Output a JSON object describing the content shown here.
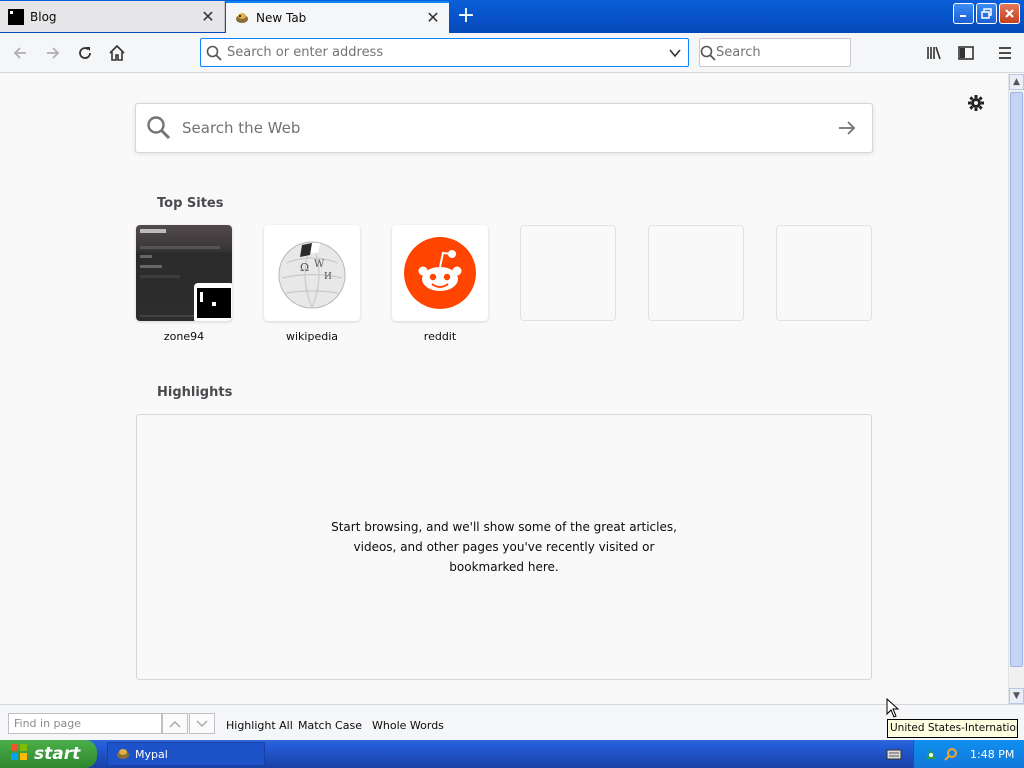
{
  "tabs": [
    {
      "label": "Blog",
      "active": false
    },
    {
      "label": "New Tab",
      "active": true
    }
  ],
  "navbar": {
    "url_placeholder": "Search or enter address",
    "search_placeholder": "Search"
  },
  "newtab": {
    "web_search_placeholder": "Search the Web",
    "top_sites_title": "Top Sites",
    "top_sites": [
      {
        "name": "zone94"
      },
      {
        "name": "wikipedia"
      },
      {
        "name": "reddit"
      },
      {
        "name": ""
      },
      {
        "name": ""
      },
      {
        "name": ""
      }
    ],
    "highlights_title": "Highlights",
    "highlights_empty": "Start browsing, and we'll show some of the great articles, videos, and other pages you've recently visited or bookmarked here."
  },
  "findbar": {
    "placeholder": "Find in page",
    "highlight_all": "Highlight All",
    "match_case": "Match Case",
    "whole_words": "Whole Words"
  },
  "tooltip": "United States-International",
  "taskbar": {
    "start_label": "start",
    "task_label": "Mypal",
    "clock": "1:48 PM"
  },
  "colors": {
    "accent": "#0a84ff",
    "reddit": "#ff4500",
    "taskbar": "#245edb",
    "start": "#3c9b3c"
  }
}
